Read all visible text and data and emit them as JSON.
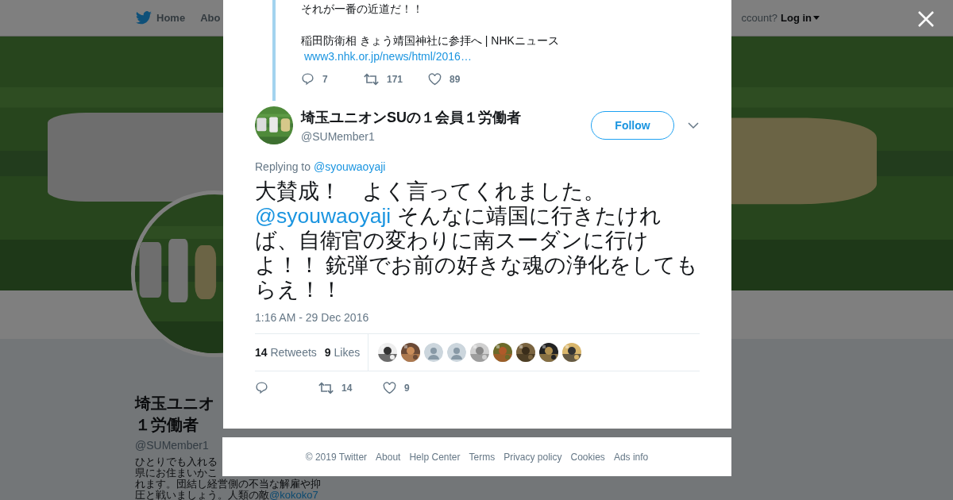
{
  "nav": {
    "items": [
      {
        "label": "Home",
        "kind": "home"
      },
      {
        "label": "Abo",
        "kind": "plain"
      }
    ],
    "account_prompt": "ccount?",
    "login": "Log in"
  },
  "profile": {
    "name_lines": [
      "埼玉ユニオ",
      "１労働者"
    ],
    "handle": "@SUMember1",
    "bio_lines": [
      {
        "text": "ひとりでも入れる"
      },
      {
        "text": "県にお住まいかこ"
      },
      {
        "text": "れます。団結し経営側の不当な解雇や抑"
      },
      {
        "text": "圧と戦いましょう。人類の敵",
        "link": "@kokoko7"
      }
    ]
  },
  "previous_tweet": {
    "lines": [
      "それが一番の近道だ！！",
      "稲田防衛相 きょう靖国神社に参拝へ | NHKニュース"
    ],
    "link": "www3.nhk.or.jp/news/html/2016…",
    "replies": "7",
    "retweets": "171",
    "likes": "89"
  },
  "tweet": {
    "name": "埼玉ユニオンSUの１会員１労働者",
    "handle": "@SUMember1",
    "follow": "Follow",
    "replying_label": "Replying to",
    "replying_to": "@syouwaoyaji",
    "text_before": "大賛成！　よく言ってくれました。\n",
    "mention": "@syouwaoyaji",
    "text_after": " そんなに靖国に行きたければ、自衛官の変わりに南スーダンに行けよ！！ 銃弾でお前の好きな魂の浄化をしてもらえ！！",
    "time": "1:16 AM - 29 Dec 2016",
    "retweet_count": "14",
    "retweet_label": "Retweets",
    "like_count": "9",
    "like_label": "Likes",
    "likers": [
      {
        "kind": "picture"
      },
      {
        "kind": "picture"
      },
      {
        "kind": "default"
      },
      {
        "kind": "default"
      },
      {
        "kind": "picture"
      },
      {
        "kind": "picture"
      },
      {
        "kind": "picture"
      },
      {
        "kind": "picture"
      },
      {
        "kind": "picture"
      }
    ],
    "action_retweets": "14",
    "action_likes": "9"
  },
  "footer": [
    "© 2019 Twitter",
    "About",
    "Help Center",
    "Terms",
    "Privacy policy",
    "Cookies",
    "Ads info"
  ]
}
